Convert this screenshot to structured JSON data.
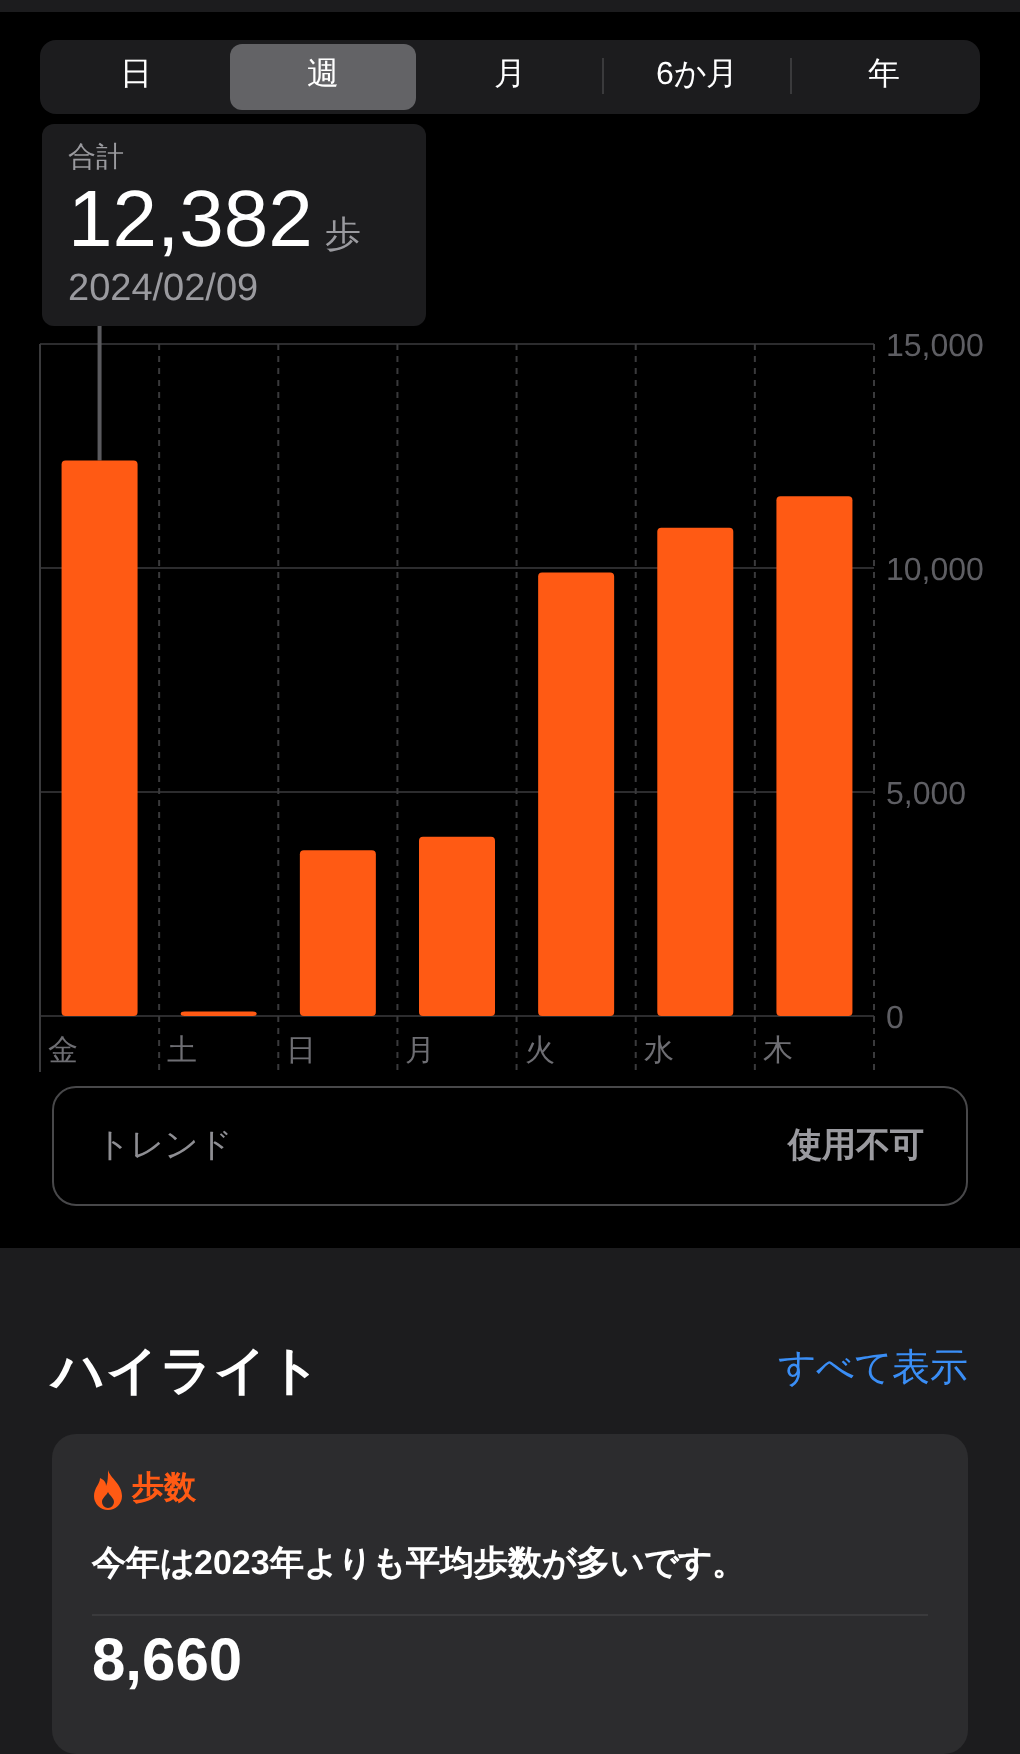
{
  "tabs": [
    {
      "label": "日",
      "selected": false
    },
    {
      "label": "週",
      "selected": true
    },
    {
      "label": "月",
      "selected": false
    },
    {
      "label": "6か月",
      "selected": false
    },
    {
      "label": "年",
      "selected": false
    }
  ],
  "summary": {
    "label": "合計",
    "value": "12,382",
    "unit": "歩",
    "date": "2024/02/09"
  },
  "chart_data": {
    "type": "bar",
    "categories": [
      "金",
      "土",
      "日",
      "月",
      "火",
      "水",
      "木"
    ],
    "values": [
      12400,
      100,
      3700,
      4000,
      9900,
      10900,
      11600
    ],
    "ylim": [
      0,
      15000
    ],
    "yticks": [
      {
        "value": 0,
        "label": "0"
      },
      {
        "value": 5000,
        "label": "5,000"
      },
      {
        "value": 10000,
        "label": "10,000"
      },
      {
        "value": 15000,
        "label": "15,000"
      }
    ]
  },
  "trend": {
    "label": "トレンド",
    "value": "使用不可"
  },
  "highlights": {
    "title": "ハイライト",
    "link": "すべて表示",
    "card": {
      "category": "歩数",
      "text": "今年は2023年よりも平均歩数が多いです。",
      "value": "8,660"
    }
  }
}
